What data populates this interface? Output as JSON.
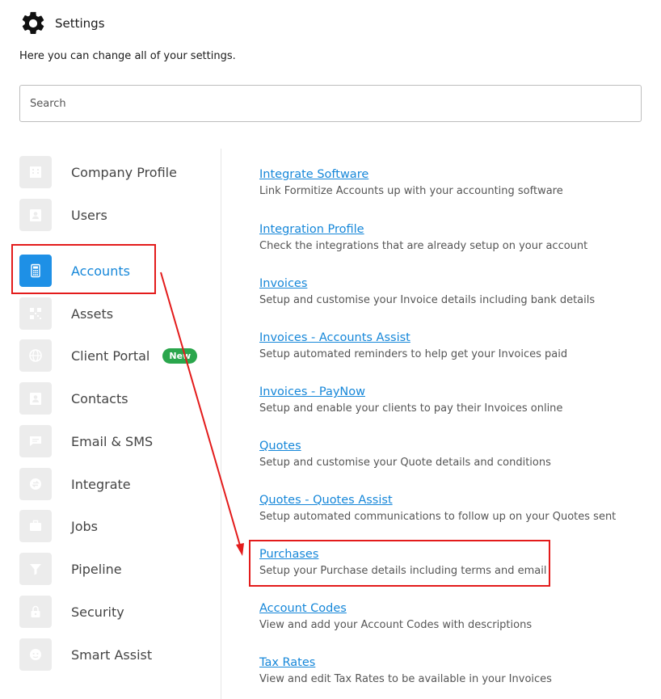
{
  "header": {
    "title": "Settings",
    "icon": "gear-icon"
  },
  "subtitle": "Here you can change all of your settings.",
  "search": {
    "placeholder": "Search",
    "value": ""
  },
  "sidebar": {
    "items": [
      {
        "label": "Company Profile",
        "icon": "building-icon"
      },
      {
        "label": "Users",
        "icon": "user-card-icon"
      },
      {
        "label": "Accounts",
        "icon": "calculator-icon",
        "active": true
      },
      {
        "label": "Assets",
        "icon": "qr-code-icon"
      },
      {
        "label": "Client Portal",
        "icon": "globe-icon",
        "badge": "New"
      },
      {
        "label": "Contacts",
        "icon": "contact-card-icon"
      },
      {
        "label": "Email & SMS",
        "icon": "chat-icon"
      },
      {
        "label": "Integrate",
        "icon": "integrate-icon"
      },
      {
        "label": "Jobs",
        "icon": "briefcase-icon"
      },
      {
        "label": "Pipeline",
        "icon": "funnel-icon"
      },
      {
        "label": "Security",
        "icon": "lock-icon"
      },
      {
        "label": "Smart Assist",
        "icon": "smart-assist-icon"
      }
    ]
  },
  "content": {
    "entries": [
      {
        "title": "Integrate Software",
        "desc": "Link Formitize Accounts up with your accounting software"
      },
      {
        "title": "Integration Profile",
        "desc": "Check the integrations that are already setup on your account"
      },
      {
        "title": "Invoices",
        "desc": "Setup and customise your Invoice details including bank details"
      },
      {
        "title": "Invoices - Accounts Assist",
        "desc": "Setup automated reminders to help get your Invoices paid"
      },
      {
        "title": "Invoices - PayNow",
        "desc": "Setup and enable your clients to pay their Invoices online"
      },
      {
        "title": "Quotes",
        "desc": "Setup and customise your Quote details and conditions"
      },
      {
        "title": "Quotes - Quotes Assist",
        "desc": "Setup automated communications to follow up on your Quotes sent"
      },
      {
        "title": "Purchases",
        "desc": "Setup your Purchase details including terms and email"
      },
      {
        "title": "Account Codes",
        "desc": "View and add your Account Codes with descriptions"
      },
      {
        "title": "Tax Rates",
        "desc": "View and edit Tax Rates to be available in your Invoices"
      }
    ]
  },
  "colors": {
    "accent": "#1687d9",
    "active_icon_bg": "#1e90e6",
    "highlight": "#e31b1b",
    "badge": "#2aa64c"
  }
}
